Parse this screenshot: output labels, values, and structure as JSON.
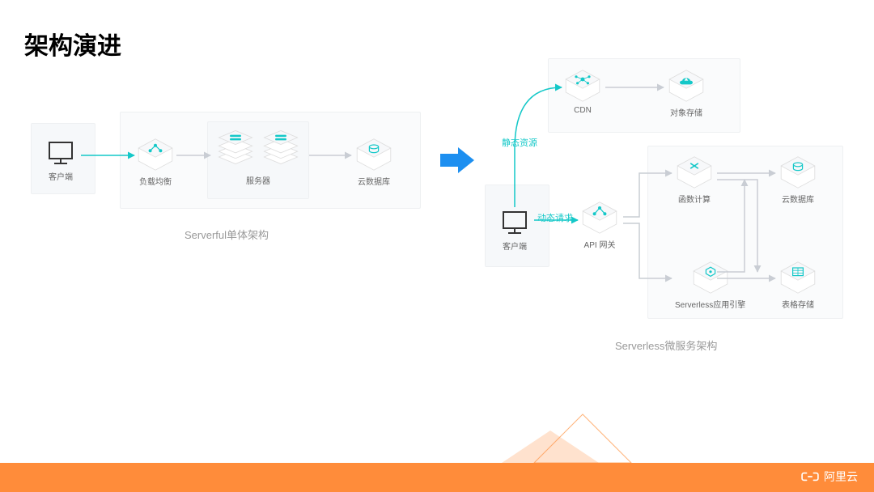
{
  "title": "架构演进",
  "left": {
    "caption": "Serverful单体架构",
    "nodes": {
      "client": "客户端",
      "lb": "负载均衡",
      "servers": "服务器",
      "db": "云数据库"
    }
  },
  "right": {
    "caption": "Serverless微服务架构",
    "nodes": {
      "client": "客户端",
      "cdn": "CDN",
      "oss": "对象存储",
      "apigw": "API 网关",
      "fc": "函数计算",
      "sae": "Serverless应用引擎",
      "rds": "云数据库",
      "ots": "表格存储"
    },
    "edges": {
      "static": "静态资源",
      "dynamic": "动态请求"
    }
  },
  "brand": "阿里云"
}
